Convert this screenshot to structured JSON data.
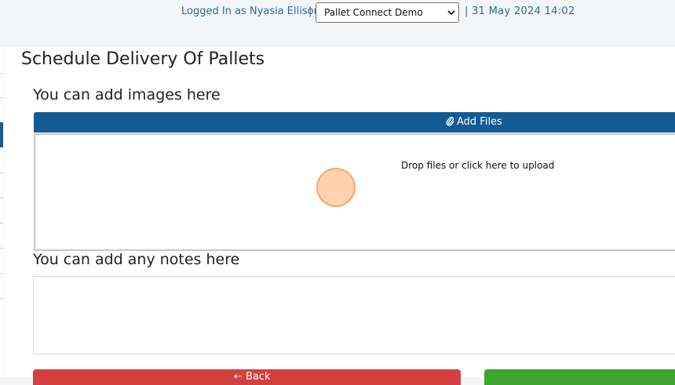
{
  "header": {
    "logged_in_text": "Logged In as Nyasia Ellison",
    "separator": "|",
    "company_select": {
      "selected": "Pallet Connect Demo",
      "icon": "chevron-down-icon"
    },
    "datetime": "| 31 May 2024 14:02"
  },
  "page": {
    "title": "Schedule Delivery Of Pallets"
  },
  "images_section": {
    "label": "You can add images here",
    "add_files_label": "Add Files",
    "add_files_icon": "paperclip-icon",
    "dropzone_text": "Drop files or click here to upload"
  },
  "notes_section": {
    "label": "You can add any notes here",
    "value": ""
  },
  "actions": {
    "back_label": "⇠ Back"
  },
  "colors": {
    "primary": "#155b93",
    "link_text": "#2b6a9e",
    "danger": "#d2403f",
    "success": "#3ea52f"
  }
}
